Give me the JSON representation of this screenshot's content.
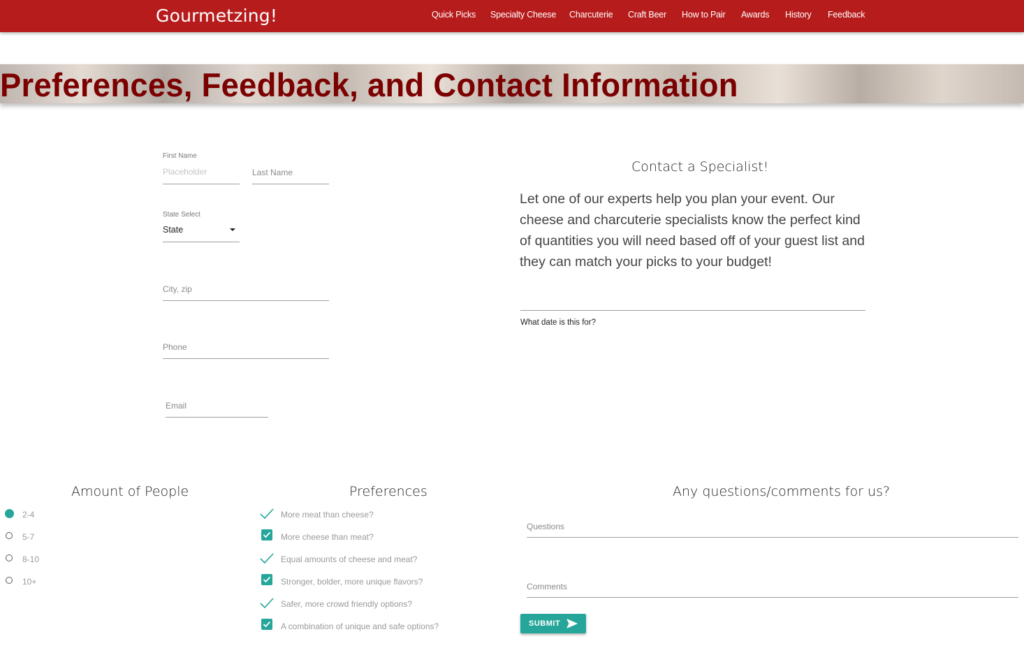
{
  "nav": {
    "brand": "Gourmetzing!",
    "items": [
      "Quick Picks",
      "Specialty Cheese",
      "Charcuterie",
      "Craft Beer",
      "How to Pair",
      "Awards",
      "History",
      "Feedback"
    ]
  },
  "banner": {
    "title": "Preferences, Feedback, and Contact Information"
  },
  "form": {
    "first_name_label": "First Name",
    "first_name_placeholder": "Placeholder",
    "last_name_label": "Last Name",
    "state_label": "State Select",
    "state_value": "State",
    "city_label": "City, zip",
    "phone_label": "Phone",
    "email_label": "Email"
  },
  "contact": {
    "title": "Contact a Specialist!",
    "body": "Let one of our experts help you plan your event. Our cheese and charcuterie specialists know the perfect kind of quantities you will need based off of your guest list and they can match your picks to your budget!",
    "date_label": "What date is this for?"
  },
  "people": {
    "title": "Amount of People",
    "selected": "2-4",
    "options": [
      "2-4",
      "5-7",
      "8-10",
      "10+"
    ]
  },
  "preferences": {
    "title": "Preferences",
    "options": [
      {
        "label": "More meat than cheese?",
        "style": "check-outline"
      },
      {
        "label": "More cheese than meat?",
        "style": "check-filled"
      },
      {
        "label": "Equal amounts of cheese and meat?",
        "style": "check-outline"
      },
      {
        "label": "Stronger, bolder, more unique flavors?",
        "style": "check-filled"
      },
      {
        "label": "Safer, more crowd friendly options?",
        "style": "check-outline"
      },
      {
        "label": "A combination of unique and safe options?",
        "style": "check-filled"
      }
    ]
  },
  "comments": {
    "title": "Any questions/comments for us?",
    "questions_label": "Questions",
    "comments_label": "Comments",
    "submit_label": "SUBMIT"
  },
  "colors": {
    "nav_bg": "#b71c1c",
    "accent": "#26a69a",
    "banner_title": "#7b0000"
  },
  "icons": {
    "submit": "send-icon",
    "state_dropdown": "caret-down-icon"
  }
}
